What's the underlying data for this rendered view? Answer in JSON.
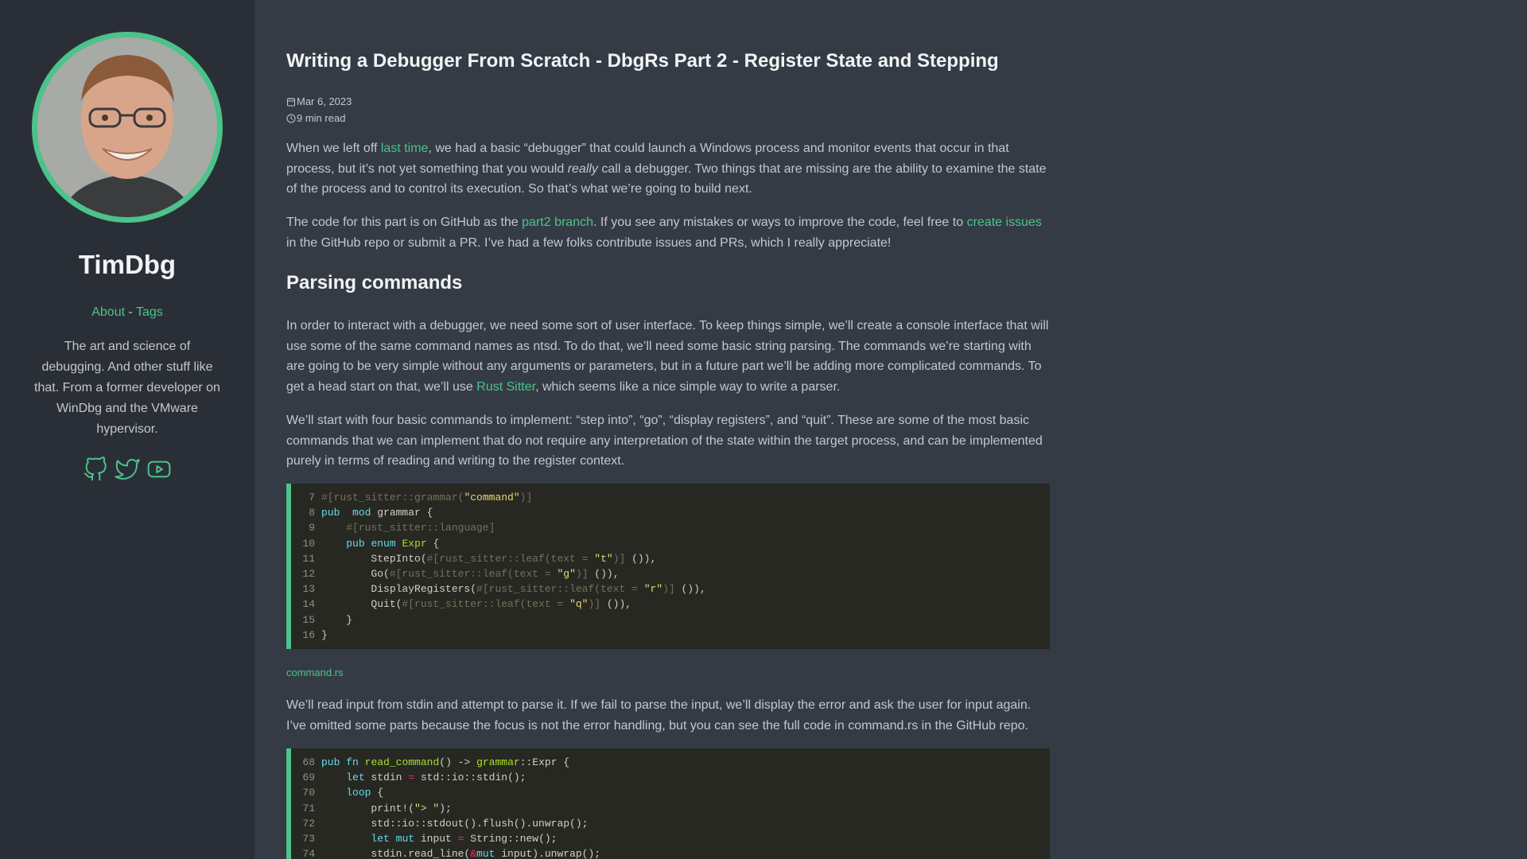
{
  "sidebar": {
    "site_title": "TimDbg",
    "nav": {
      "about": "About",
      "separator": " - ",
      "tags": "Tags"
    },
    "bio": "The art and science of debugging. And other stuff like that. From a former developer on WinDbg and the VMware hypervisor.",
    "social_icons": [
      "github-icon",
      "twitter-icon",
      "youtube-icon"
    ],
    "accent_color": "#4cc38a"
  },
  "post": {
    "title": "Writing a Debugger From Scratch - DbgRs Part 2 - Register State and Stepping",
    "date": "Mar 6, 2023",
    "read_time": "9 min read",
    "p1": {
      "a": "When we left off ",
      "link": "last time",
      "b": ", we had a basic “debugger” that could launch a Windows process and monitor events that occur in that process, but it’s not yet something that you would ",
      "em": "really",
      "c": " call a debugger. Two things that are missing are the ability to examine the state of the process and to control its execution. So that’s what we’re going to build next."
    },
    "p2": {
      "a": "The code for this part is on GitHub as the ",
      "link1": "part2 branch",
      "b": ". If you see any mistakes or ways to improve the code, feel free to ",
      "link2": "create issues",
      "c": " in the GitHub repo or submit a PR. I’ve had a few folks contribute issues and PRs, which I really appreciate!"
    },
    "h2": "Parsing commands",
    "p3": {
      "a": "In order to interact with a debugger, we need some sort of user interface. To keep things simple, we’ll create a console interface that will use some of the same command names as ntsd. To do that, we’ll need some basic string parsing. The commands we’re starting with are going to be very simple without any arguments or parameters, but in a future part we’ll be adding more complicated commands. To get a head start on that, we’ll use ",
      "link": "Rust Sitter",
      "b": ", which seems like a nice simple way to write a parser."
    },
    "p4": "We’ll start with four basic commands to implement: “step into”, “go”, “display registers”, and “quit”. These are some of the most basic commands that we can implement that do not require any interpretation of the state within the target process, and can be implemented purely in terms of reading and writing to the register context.",
    "code1": {
      "lines": [
        {
          "n": "7",
          "t": [
            [
              "m",
              "#[rust_sitter::grammar("
            ],
            [
              "s",
              "\"command\""
            ],
            [
              "m",
              ")]"
            ]
          ]
        },
        {
          "n": "8",
          "t": [
            [
              "k",
              "pub"
            ],
            [
              "",
              "  "
            ],
            [
              "k",
              "mod"
            ],
            [
              "",
              " grammar {"
            ]
          ]
        },
        {
          "n": "9",
          "t": [
            [
              "",
              "    "
            ],
            [
              "m",
              "#[rust_sitter::language]"
            ]
          ]
        },
        {
          "n": "10",
          "t": [
            [
              "",
              "    "
            ],
            [
              "k",
              "pub"
            ],
            [
              "",
              " "
            ],
            [
              "k",
              "enum"
            ],
            [
              "",
              " "
            ],
            [
              "f",
              "Expr"
            ],
            [
              "",
              " {"
            ]
          ]
        },
        {
          "n": "11",
          "t": [
            [
              "",
              "        StepInto("
            ],
            [
              "m",
              "#[rust_sitter::leaf(text = "
            ],
            [
              "s",
              "\"t\""
            ],
            [
              "m",
              ")]"
            ],
            [
              "",
              " ()),"
            ]
          ]
        },
        {
          "n": "12",
          "t": [
            [
              "",
              "        Go("
            ],
            [
              "m",
              "#[rust_sitter::leaf(text = "
            ],
            [
              "s",
              "\"g\""
            ],
            [
              "m",
              ")]"
            ],
            [
              "",
              " ()),"
            ]
          ]
        },
        {
          "n": "13",
          "t": [
            [
              "",
              "        DisplayRegisters("
            ],
            [
              "m",
              "#[rust_sitter::leaf(text = "
            ],
            [
              "s",
              "\"r\""
            ],
            [
              "m",
              ")]"
            ],
            [
              "",
              " ()),"
            ]
          ]
        },
        {
          "n": "14",
          "t": [
            [
              "",
              "        Quit("
            ],
            [
              "m",
              "#[rust_sitter::leaf(text = "
            ],
            [
              "s",
              "\"q\""
            ],
            [
              "m",
              ")]"
            ],
            [
              "",
              " ()),"
            ]
          ]
        },
        {
          "n": "15",
          "t": [
            [
              "",
              "    }"
            ]
          ]
        },
        {
          "n": "16",
          "t": [
            [
              "",
              "}"
            ]
          ]
        }
      ]
    },
    "caption": "command.rs",
    "p5": "We’ll read input from stdin and attempt to parse it. If we fail to parse the input, we’ll display the error and ask the user for input again. I’ve omitted some parts because the focus is not the error handling, but you can see the full code in command.rs in the GitHub repo.",
    "code2": {
      "lines": [
        {
          "n": "68",
          "t": [
            [
              "k",
              "pub"
            ],
            [
              "",
              " "
            ],
            [
              "k",
              "fn"
            ],
            [
              "",
              " "
            ],
            [
              "f",
              "read_command"
            ],
            [
              "",
              "() -> "
            ],
            [
              "f",
              "grammar"
            ],
            [
              "",
              "::Expr {"
            ]
          ]
        },
        {
          "n": "69",
          "t": [
            [
              "",
              "    "
            ],
            [
              "k",
              "let"
            ],
            [
              "",
              " stdin "
            ],
            [
              "o",
              "="
            ],
            [
              "",
              " std::io::stdin();"
            ]
          ]
        },
        {
          "n": "70",
          "t": [
            [
              "",
              "    "
            ],
            [
              "k",
              "loop"
            ],
            [
              "",
              " {"
            ]
          ]
        },
        {
          "n": "71",
          "t": [
            [
              "",
              "        print!("
            ],
            [
              "s",
              "\"> \""
            ],
            [
              "",
              ");"
            ]
          ]
        },
        {
          "n": "72",
          "t": [
            [
              "",
              "        std::io::stdout().flush().unwrap();"
            ]
          ]
        },
        {
          "n": "73",
          "t": [
            [
              "",
              "        "
            ],
            [
              "k",
              "let"
            ],
            [
              "",
              " "
            ],
            [
              "k",
              "mut"
            ],
            [
              "",
              " input "
            ],
            [
              "o",
              "="
            ],
            [
              "",
              " String::new();"
            ]
          ]
        },
        {
          "n": "74",
          "t": [
            [
              "",
              "        stdin.read_line("
            ],
            [
              "o",
              "&"
            ],
            [
              "k",
              "mut"
            ],
            [
              "",
              " input).unwrap();"
            ]
          ]
        }
      ]
    }
  }
}
